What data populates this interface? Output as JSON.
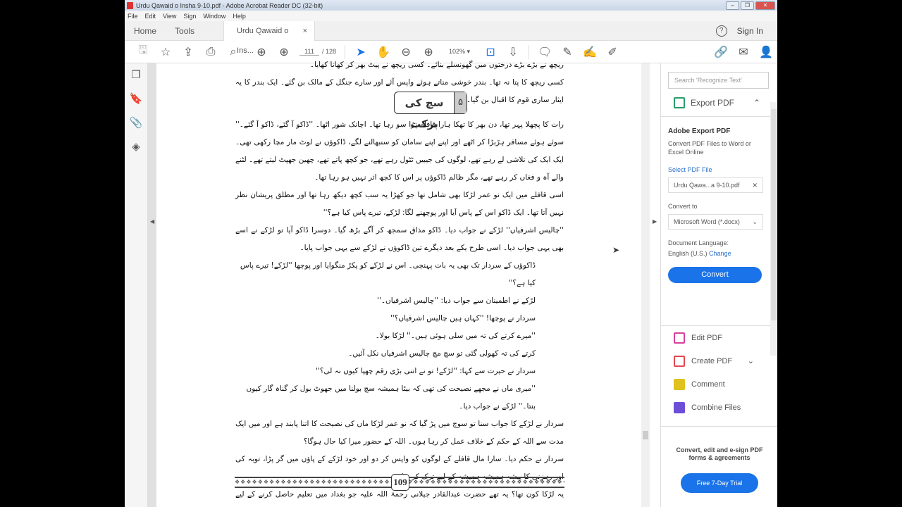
{
  "window": {
    "title": "Urdu Qawaid o Insha 9-10.pdf - Adobe Acrobat Reader DC (32-bit)"
  },
  "menu": [
    "File",
    "Edit",
    "View",
    "Sign",
    "Window",
    "Help"
  ],
  "tabs": {
    "home": "Home",
    "tools": "Tools",
    "doc": "Urdu Qawaid o Ins...",
    "close": "×",
    "sign_in": "Sign In",
    "help": "?"
  },
  "toolbar": {
    "page_current": "111",
    "page_total": "/ 128",
    "zoom": "102%"
  },
  "page": {
    "top_line": "ریچھ نے بڑے بڑے درختوں میں گھونسلے بنائے۔ کسی ریچھ نے پیٹ بھر کر کھانا کھایا۔",
    "line2": "کسی ریچھ کا پتا نہ تھا۔ بندر خوشی مناتے ہوئے واپس آئے اور سارے جنگل کے مالک بن گئے۔ ایک بندر کا یہ ایثار ساری قوم کا اقبال بن گیا۔",
    "lesson_number": "۵",
    "lesson_title": "سچ کی برکت",
    "p1": "رات کا پچھلا پہر تھا، دن بھر کا تھکا ہارا قافلہ پڑا سو رہا تھا۔ اچانک شور اٹھا۔ ''ڈاکو آ گئے، ڈاکو آ گئے۔'' سوئے ہوئے مسافر ہڑبڑا کر اٹھے اور اپنے اپنے سامان کو سنبھالنے لگے، ڈاکوؤں نے لوٹ مار مچا رکھی تھی۔ ایک ایک کی تلاشی لے رہے تھے، لوگوں کی جیبیں ٹٹول رہے تھے، جو کچھ پاتے تھے، چھین جھپٹ لیتے تھے۔ لٹنے والے آہ و فغاں کر رہے تھے، مگر ظالم ڈاکوؤں پر اس کا کچھ اثر نہیں ہو رہا تھا۔",
    "p2": "اسی قافلے میں ایک نو عمر لڑکا بھی شامل تھا جو کھڑا یہ سب کچھ دیکھ رہا تھا اور مطلق پریشان نظر نہیں آتا تھا۔ ایک ڈاکو اس کے پاس آیا اور پوچھنے لگا: لڑکے، تیرے پاس کیا ہے؟''",
    "p3": "''چالیس اشرفیاں'' لڑکے نے جواب دیا۔ ڈاکو مذاق سمجھ کر آگے بڑھ گیا۔ دوسرا ڈاکو آیا تو لڑکے نے اسے بھی یہی جواب دیا۔ اسی طرح یکے بعد دیگرے تین ڈاکوؤں نے لڑکے سے یہی جواب پایا۔",
    "dialogue": [
      "ڈاکوؤں کے سردار تک بھی یہ بات پہنچی۔ اس نے لڑکے کو پکڑ منگوایا اور پوچھا ''لڑکے! تیرے پاس کیا ہے؟''",
      "لڑکے نے اطمینان سے جواب دیا: ''چالیس اشرفیاں۔''",
      "سردار نے پوچھا! ''کہاں ہیں چالیس اشرفیاں؟''",
      "''میرے کرتے کی تہ میں سلی ہوئی ہیں۔'' لڑکا بولا۔",
      "کرتے کی تہ کھولی گئی تو سچ مچ چالیس اشرفیاں نکل آئیں۔",
      "سردار نے حیرت سے کہا: ''لڑکے! تو نے اتنی بڑی رقم چھپا کیوں نہ لی؟''",
      "''میری ماں نے مجھے نصیحت کی تھی کہ بیٹا ہمیشہ سچ بولنا میں جھوٹ بول کر گناہ گار کیوں بنتا۔'' لڑکے نے جواب دیا۔"
    ],
    "p4": "سردار نے لڑکے کا جواب سنا تو سوچ میں پڑ گیا کہ نو عمر لڑکا ماں کی نصیحت کا اتنا پابند ہے اور میں ایک مدت سے اللہ کے حکم کے خلاف عمل کر رہا ہوں۔ اللہ کے حضور میرا کیا حال ہوگا؟",
    "p5": "سردار نے حکم دیا۔ سارا مال قافلے کے لوگوں کو واپس کر دو اور خود لڑکے کے پاؤں میں گر پڑا، توبہ کی اور رہزنی کا پیشہ ہمیشہ ہمیشہ کے لیے ترک کر دیا۔",
    "p6": "یہ لڑکا کون تھا؟ یہ تھے حضرت عبدالقادر جیلانی رحمۃ اللہ علیہ جو بغداد میں تعلیم حاصل کرنے کے لیے قافلے کے ساتھ سفر کر رہے تھے۔ ان کے سچ کی برکت سے پیشہ ور ڈاکو توبہ کر کے نیک بن گئے۔",
    "page_number": "109"
  },
  "right_panel": {
    "search_placeholder": "Search 'Recognize Text'",
    "export_pdf": "Export PDF",
    "adobe_export_title": "Adobe Export PDF",
    "adobe_export_desc": "Convert PDF Files to Word or Excel Online",
    "select_file": "Select PDF File",
    "file_name": "Urdu Qawa...a 9-10.pdf",
    "convert_to": "Convert to",
    "format": "Microsoft Word (*.docx)",
    "doc_language": "Document Language:",
    "language": "English (U.S.)",
    "change": "Change",
    "convert": "Convert",
    "tools": [
      {
        "label": "Edit PDF",
        "color": "#d6409f"
      },
      {
        "label": "Create PDF",
        "color": "#e34850"
      },
      {
        "label": "Comment",
        "color": "#e0c11d"
      },
      {
        "label": "Combine Files",
        "color": "#6c4ed8"
      }
    ],
    "promo": "Convert, edit and e-sign PDF forms & agreements",
    "trial": "Free 7-Day Trial"
  }
}
